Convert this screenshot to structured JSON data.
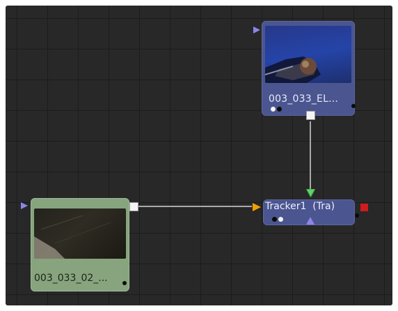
{
  "nodes": {
    "element": {
      "label": "003_033_EL..."
    },
    "plate": {
      "label": "003_033_02_..."
    },
    "tracker": {
      "label": "Tracker1  (Tra)"
    }
  },
  "colors": {
    "canvas": "#282828",
    "grid": "#1c1c1c",
    "node_media_in": "#4b5590",
    "node_plate": "#87a47e",
    "wire": "#d6d6d6",
    "input_foreground": "#5fd36a",
    "input_background": "#f0a000",
    "input_effect_mask": "#8c86e6",
    "output": "#d01c1c"
  },
  "icons": {
    "view_indicator": "circle-dot",
    "input_arrow": "triangle",
    "output_port": "square"
  }
}
